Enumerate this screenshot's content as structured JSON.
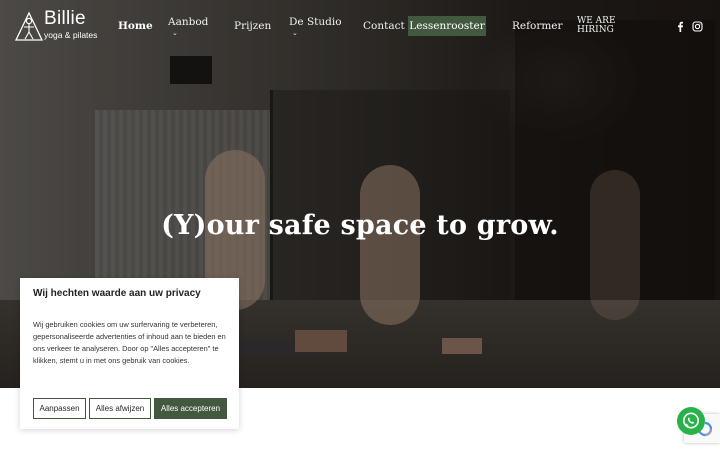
{
  "brand": {
    "name": "Billie",
    "tagline": "yoga & pilates",
    "logo_icon": "yoga-figure-triangle-icon"
  },
  "nav": {
    "items": [
      {
        "label": "Home",
        "active": true
      },
      {
        "label": "Aanbod",
        "dropdown": true
      },
      {
        "label": "Prijzen"
      },
      {
        "label": "De Studio",
        "dropdown": true
      },
      {
        "label": "Contact"
      },
      {
        "label": "Lessenrooster",
        "highlight": true
      },
      {
        "label": "Reformer"
      }
    ],
    "hiring_line1": "WE ARE",
    "hiring_line2": "HIRING",
    "social": [
      "facebook-icon",
      "instagram-icon"
    ]
  },
  "hero": {
    "title": "(Y)our safe space to grow."
  },
  "cookie": {
    "title": "Wij hechten waarde aan uw privacy",
    "body": "Wij gebruiken cookies om uw surfervaring te verbeteren, gepersonaliseerde advertenties of inhoud aan te bieden en ons verkeer te analyseren. Door op \"Alles accepteren\" te klikken, stemt u in met ons gebruik van cookies.",
    "buttons": {
      "customize": "Aanpassen",
      "reject": "Alles afwijzen",
      "accept": "Alles accepteren"
    }
  },
  "widgets": {
    "whatsapp": "whatsapp-icon",
    "recaptcha": "recaptcha-icon"
  },
  "colors": {
    "accent": "#42593f",
    "whatsapp": "#29b14a",
    "nav_text": "#ffffff"
  }
}
